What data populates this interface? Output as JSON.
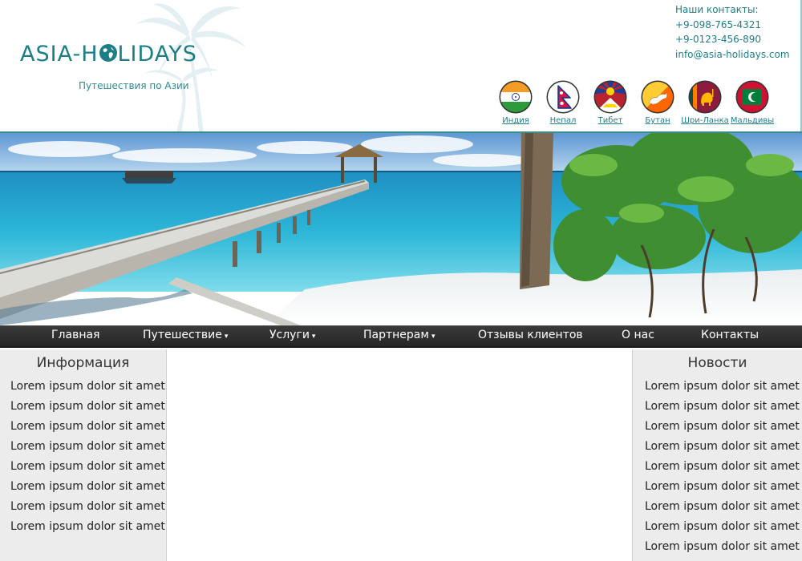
{
  "header": {
    "logo_text": "ASIA-H",
    "logo_text_end": "LIDAYS",
    "tagline": "Путешествия по Азии",
    "contacts": {
      "title": "Наши контакты:",
      "phone1": "+9-098-765-4321",
      "phone2": "+9-0123-456-890",
      "email": "info@asia-holidays.com"
    },
    "flags": [
      {
        "label": "Индия",
        "icon": "india-flag-icon"
      },
      {
        "label": "Непал",
        "icon": "nepal-flag-icon"
      },
      {
        "label": "Тибет",
        "icon": "tibet-flag-icon"
      },
      {
        "label": "Бутан",
        "icon": "bhutan-flag-icon"
      },
      {
        "label": "Шри-Ланка",
        "icon": "sri-lanka-flag-icon"
      },
      {
        "label": "Мальдивы",
        "icon": "maldives-flag-icon"
      }
    ]
  },
  "nav": {
    "items": [
      {
        "label": "Главная",
        "dropdown": false
      },
      {
        "label": "Путешествие",
        "dropdown": true
      },
      {
        "label": "Услуги",
        "dropdown": true
      },
      {
        "label": "Партнерам",
        "dropdown": true
      },
      {
        "label": "Отзывы клиентов",
        "dropdown": false
      },
      {
        "label": "О нас",
        "dropdown": false
      },
      {
        "label": "Контакты",
        "dropdown": false
      }
    ],
    "dropdown_arrow": "▾"
  },
  "left": {
    "title": "Информация",
    "items": [
      "Lorem ipsum dolor sit amet",
      "Lorem ipsum dolor sit amet",
      "Lorem ipsum dolor sit amet",
      "Lorem ipsum dolor sit amet",
      "Lorem ipsum dolor sit amet",
      "Lorem ipsum dolor sit amet",
      "Lorem ipsum dolor sit amet",
      "Lorem ipsum dolor sit amet"
    ]
  },
  "right": {
    "title": "Новости",
    "items": [
      "Lorem ipsum dolor sit amet",
      "Lorem ipsum dolor sit amet",
      "Lorem ipsum dolor sit amet",
      "Lorem ipsum dolor sit amet",
      "Lorem ipsum dolor sit amet",
      "Lorem ipsum dolor sit amet",
      "Lorem ipsum dolor sit amet",
      "Lorem ipsum dolor sit amet",
      "Lorem ipsum dolor sit amet"
    ]
  },
  "colors": {
    "accent": "#1d7f86",
    "nav_bg": "#2e2e2e",
    "sidebar_bg": "#ececec"
  }
}
